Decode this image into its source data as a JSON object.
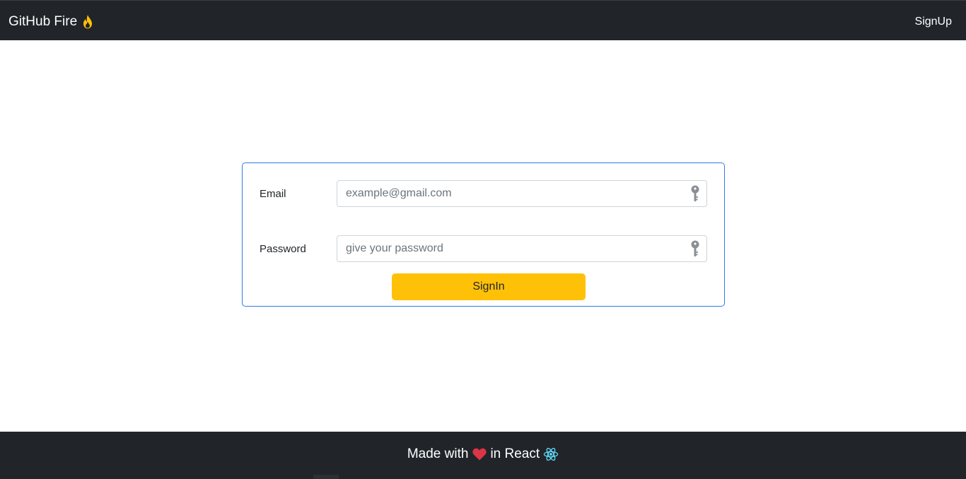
{
  "navbar": {
    "brand": "GitHub Fire",
    "brand_icon": "flame-icon",
    "signup_link": "SignUp",
    "background": "#212529"
  },
  "form": {
    "email_label": "Email",
    "email_placeholder": "example@gmail.com",
    "email_value": "",
    "password_label": "Password",
    "password_placeholder": "give your password",
    "password_value": "",
    "field_icon": "key-icon",
    "signin_label": "SignIn",
    "border_color": "#2f7be5",
    "button_color": "#ffc107"
  },
  "footer": {
    "text_before": "Made with",
    "heart_icon": "heart-icon",
    "text_after": "in React",
    "react_icon": "react-icon",
    "heart_color": "#dc3545",
    "react_color": "#61dafb"
  }
}
